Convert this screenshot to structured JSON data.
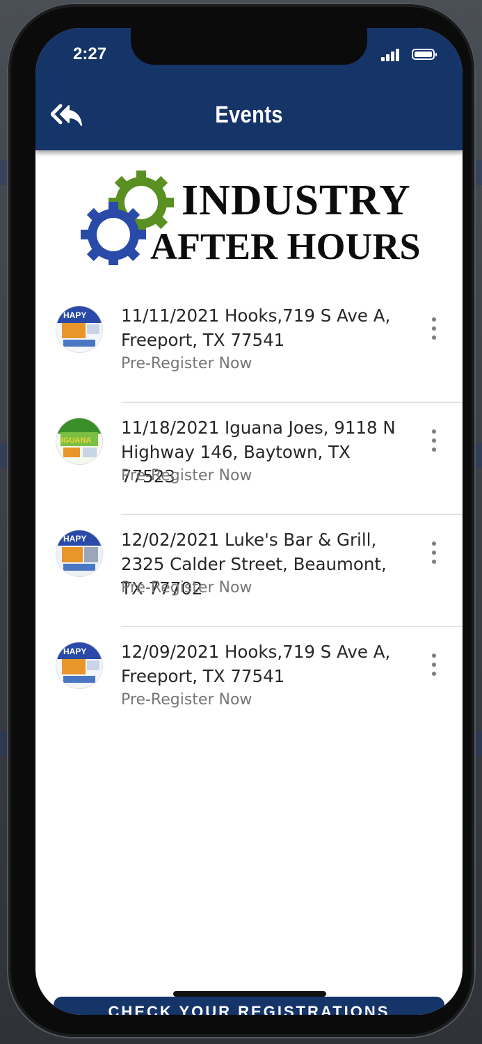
{
  "status_bar": {
    "time": "2:27"
  },
  "header": {
    "title": "Events",
    "back_icon": "double-reply-arrow-icon"
  },
  "logo": {
    "line1": "INDUSTRY",
    "line2": "AFTER HOURS",
    "colors": {
      "gear_green": "#5a8f22",
      "gear_blue": "#2a4aa8"
    }
  },
  "events": [
    {
      "title": "11/11/2021 Hooks,719 S Ave A, Freeport, TX 77541",
      "subtitle": "Pre-Register Now",
      "thumb": "happy-hour-flyer"
    },
    {
      "title": "11/18/2021 Iguana Joes, 9118 N Highway 146, Baytown, TX 77523",
      "subtitle": "Pre-Register Now",
      "thumb": "iguana-joes-flyer"
    },
    {
      "title": "12/02/2021 Luke's Bar & Grill, 2325 Calder Street, Beaumont, TX 77702",
      "subtitle": "Pre-Register Now",
      "thumb": "happy-hour-flyer"
    },
    {
      "title": "12/09/2021 Hooks,719 S Ave A, Freeport, TX 77541",
      "subtitle": "Pre-Register Now",
      "thumb": "happy-hour-flyer"
    }
  ],
  "footer": {
    "button_label": "CHECK YOUR REGISTRATIONS"
  },
  "colors": {
    "primary": "#153468",
    "text": "#262626",
    "muted": "#777777",
    "divider": "#e4e4e4"
  }
}
